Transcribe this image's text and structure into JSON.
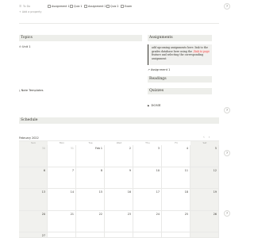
{
  "property": {
    "icon": "list-icon",
    "label": "To Do"
  },
  "add_property": "Add a property",
  "todo_items": [
    {
      "label": "Assignment 1"
    },
    {
      "label": "Quiz 1"
    },
    {
      "label": "Assignment 2"
    },
    {
      "label": "Quiz 2"
    },
    {
      "label": "Exam"
    }
  ],
  "topics": {
    "title": "Topics",
    "unit": "Unit 1",
    "notes": "Note Templates"
  },
  "assignments": {
    "title": "Assignments",
    "callout_parts": [
      "add upcoming assignments here. link to the grades database here using the ",
      "/link to page",
      " feature and selecting the corresponding assignment"
    ],
    "item": "Assignment 1"
  },
  "readings": {
    "title": "Readings"
  },
  "quizzes": {
    "title": "Quizzes",
    "item": "DONE"
  },
  "schedule": {
    "title": "Schedule",
    "month": "February 2022",
    "nav_prev": "‹",
    "nav_next": "›",
    "weekdays": [
      "Sun",
      "Mon",
      "Tue",
      "Wed",
      "Thu",
      "Fri",
      "Sat"
    ],
    "weeks": [
      [
        "30",
        "31",
        "Feb 1",
        "2",
        "3",
        "4",
        "5"
      ],
      [
        "6",
        "7",
        "8",
        "9",
        "10",
        "11",
        "12"
      ],
      [
        "13",
        "14",
        "15",
        "16",
        "17",
        "18",
        "19"
      ],
      [
        "20",
        "21",
        "22",
        "23",
        "24",
        "25",
        "26"
      ],
      [
        "27",
        "",
        "",
        "",
        "",
        "",
        ""
      ]
    ]
  },
  "side_buttons": [
    "?",
    "?",
    "?",
    "?"
  ],
  "colors": {
    "section_bg": "#edeeea",
    "callout_bg": "#f1f1ef",
    "weekend_bg": "#f1f1ee",
    "code_red": "#eb5757"
  }
}
